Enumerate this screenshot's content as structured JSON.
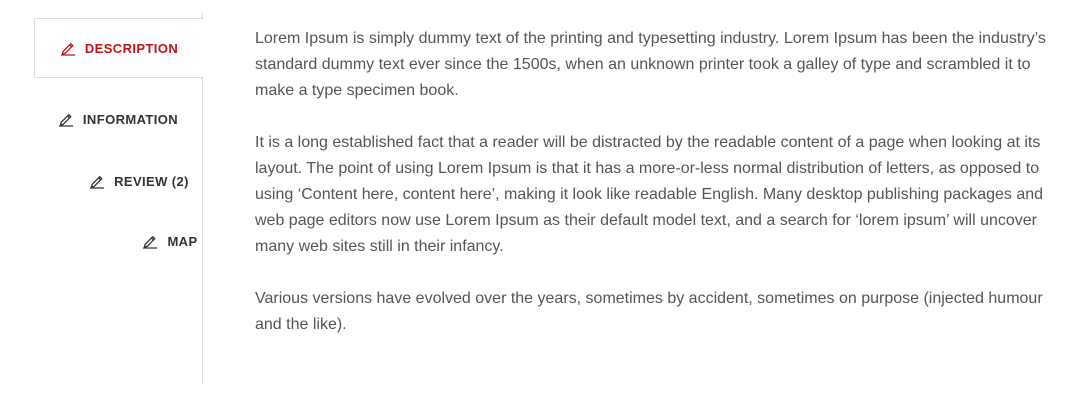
{
  "tabs": [
    {
      "label": "DESCRIPTION",
      "icon": "pencil-icon",
      "active": true
    },
    {
      "label": "INFORMATION",
      "icon": "pencil-icon",
      "active": false
    },
    {
      "label": "REVIEW (2)",
      "icon": "pencil-icon",
      "active": false
    },
    {
      "label": "MAP",
      "icon": "pencil-icon",
      "active": false
    }
  ],
  "content": {
    "paragraphs": [
      "Lorem Ipsum is simply dummy text of the printing and typesetting industry. Lorem Ipsum has been the industry’s standard dummy text ever since the 1500s, when an unknown printer took a galley of type and scrambled it to make a type specimen book.",
      "It is a long established fact that a reader will be distracted by the readable content of a page when looking at its layout. The point of using Lorem Ipsum is that it has a more-or-less normal distribution of letters, as opposed to using ‘Content here, content here’, making it look like readable English. Many desktop publishing packages and web page editors now use Lorem Ipsum as their default model text, and a search for ‘lorem ipsum’ will uncover many web sites still in their infancy.",
      "Various versions have evolved over the years, sometimes by accident, sometimes on purpose (injected humour and the like)."
    ]
  },
  "colors": {
    "active_tab": "#c1121a",
    "tab_text": "#333333",
    "body_text": "#555555",
    "divider": "#dddddd"
  }
}
